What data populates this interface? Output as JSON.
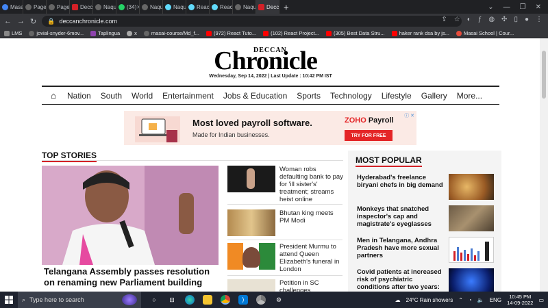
{
  "browser": {
    "tabs": [
      {
        "label": "Masa",
        "color": "#4285f4"
      },
      {
        "label": "Page",
        "color": "#666666"
      },
      {
        "label": "Page",
        "color": "#666666"
      },
      {
        "label": "Decc",
        "color": "#d32027"
      },
      {
        "label": "Naqu",
        "color": "#666666"
      },
      {
        "label": "(34)",
        "color": "#25d366"
      },
      {
        "label": "Naqu",
        "color": "#666666"
      },
      {
        "label": "Naqu",
        "color": "#61dafb"
      },
      {
        "label": "Reac",
        "color": "#61dafb"
      },
      {
        "label": "Reac",
        "color": "#61dafb"
      },
      {
        "label": "Naqu",
        "color": "#666666"
      },
      {
        "label": "Decc",
        "color": "#d32027"
      }
    ],
    "new_tab": "+",
    "url": "deccanchronicle.com",
    "bookmarks": [
      {
        "label": "LMS",
        "color": "#888888"
      },
      {
        "label": "jovial-snyder-6mov...",
        "color": "#666666"
      },
      {
        "label": "Taplingua",
        "color": "#8e44ad"
      },
      {
        "label": "x",
        "color": "#aaaaaa"
      },
      {
        "label": "masai-course/Md_f...",
        "color": "#666666"
      },
      {
        "label": "(972) React Tuto...",
        "color": "#ff0000"
      },
      {
        "label": "(102) React Project...",
        "color": "#ff0000"
      },
      {
        "label": "(305) Best Data Stru...",
        "color": "#ff0000"
      },
      {
        "label": "haker rank dsa by js...",
        "color": "#ff0000"
      },
      {
        "label": "Masai School | Cour...",
        "color": "#e74c3c"
      }
    ]
  },
  "site": {
    "logo_small": "DECCAN",
    "logo_big": "Chronicle",
    "dateline": "Wednesday, Sep 14, 2022 | Last Update : 10:42 PM IST",
    "nav": [
      "Nation",
      "South",
      "World",
      "Entertainment",
      "Jobs & Education",
      "Sports",
      "Technology",
      "Lifestyle",
      "Gallery",
      "More..."
    ]
  },
  "ad": {
    "headline": "Most loved payroll software.",
    "sub": "Made for Indian businesses.",
    "brand_z": "ZOHO",
    "brand_rest": " Payroll",
    "cta": "TRY FOR FREE"
  },
  "top_stories": {
    "title": "TOP STORIES",
    "lead_caption": "Telangana Assembly passes resolution on renaming new Parliament building",
    "items": [
      "Woman robs defaulting bank to pay for 'ill sister's' treatment; streams heist online",
      "Bhutan king meets PM Modi",
      "President Murmu to attend Queen Elizabeth's funeral in London",
      "Petition in SC challenges"
    ]
  },
  "most_popular": {
    "title": "MOST POPULAR",
    "items": [
      "Hyderabad's freelance biryani chefs in big demand",
      "Monkeys that snatched inspector's cap and magistrate's eyeglasses",
      "Men in Telangana, Andhra Pradesh have more sexual partners",
      "Covid patients at increased risk of psychiatric conditions after two years: Lancet"
    ]
  },
  "taskbar": {
    "search_placeholder": "Type here to search",
    "weather": "24°C  Rain showers",
    "lang": "ENG",
    "time": "10:45 PM",
    "date": "14-09-2022"
  }
}
